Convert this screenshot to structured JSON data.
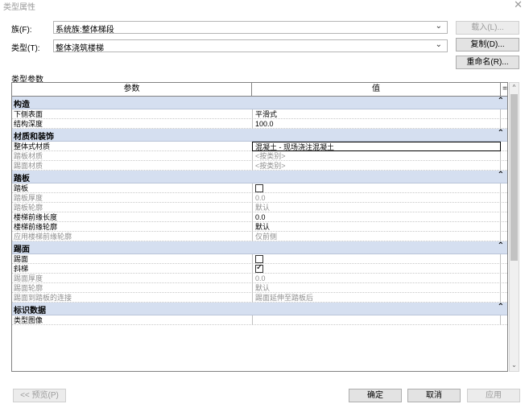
{
  "window": {
    "title": "类型属性",
    "close_glyph": "✕"
  },
  "family": {
    "label": "族(F):",
    "value": "系统族:整体梯段",
    "arrow": "⌄"
  },
  "type": {
    "label": "类型(T):",
    "value": "整体浇筑楼梯",
    "arrow": "⌄"
  },
  "buttons": {
    "load": "载入(L)...",
    "duplicate": "复制(D)...",
    "rename": "重命名(R)...",
    "preview": "<< 预览(P)",
    "ok": "确定",
    "cancel": "取消",
    "apply": "应用"
  },
  "section_title": "类型参数",
  "grid": {
    "col_param": "参数",
    "col_value": "值",
    "col_eq": "=",
    "collapse_glyph": "⌃",
    "groups": [
      {
        "name": "构造",
        "rows": [
          {
            "param": "下侧表面",
            "value": "平滑式",
            "dim": false
          },
          {
            "param": "结构深度",
            "value": "100.0",
            "dim": false
          }
        ]
      },
      {
        "name": "材质和装饰",
        "rows": [
          {
            "param": "整体式材质",
            "value": "混凝土 - 现场浇注混凝土",
            "dim": false
          },
          {
            "param": "踏板材质",
            "value": "<按类别>",
            "dim": true
          },
          {
            "param": "踢面材质",
            "value": "<按类别>",
            "dim": true
          }
        ]
      },
      {
        "name": "踏板",
        "rows": [
          {
            "param": "踏板",
            "value": "",
            "dim": false
          },
          {
            "param": "踏板厚度",
            "value": "0.0",
            "dim": true
          },
          {
            "param": "踏板轮廓",
            "value": "默认",
            "dim": true
          },
          {
            "param": "楼梯前缘长度",
            "value": "0.0",
            "dim": false
          },
          {
            "param": "楼梯前缘轮廓",
            "value": "默认",
            "dim": false
          },
          {
            "param": "应用楼梯前缘轮廓",
            "value": "仅前侧",
            "dim": true
          }
        ]
      },
      {
        "name": "踢面",
        "rows": [
          {
            "param": "踢面",
            "value": "",
            "dim": false
          },
          {
            "param": "斜梯",
            "value": "",
            "dim": false
          },
          {
            "param": "踢面厚度",
            "value": "0.0",
            "dim": true
          },
          {
            "param": "踢面轮廓",
            "value": "默认",
            "dim": true
          },
          {
            "param": "踢面到踏板的连接",
            "value": "踢面延伸至踏板后",
            "dim": true
          }
        ]
      },
      {
        "name": "标识数据",
        "rows": [
          {
            "param": "类型图像",
            "value": "",
            "dim": false
          }
        ]
      }
    ]
  },
  "checkbox_state": {
    "treads": false,
    "riser": false,
    "slanted": true
  },
  "scrollbar": {
    "up": "^",
    "down": "⌄"
  }
}
